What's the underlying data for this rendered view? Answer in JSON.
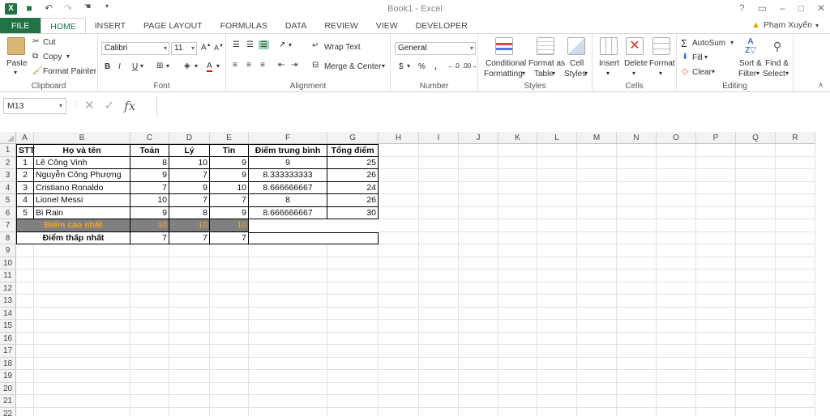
{
  "window": {
    "title": "Book1 - Excel",
    "help": "?",
    "restore": "□",
    "minimize": "–",
    "close": "✕"
  },
  "qat": {
    "save": "💾",
    "undo": "↶",
    "redo": "↷",
    "touch": "✋"
  },
  "tabs": [
    "FILE",
    "HOME",
    "INSERT",
    "PAGE LAYOUT",
    "FORMULAS",
    "DATA",
    "REVIEW",
    "VIEW",
    "DEVELOPER"
  ],
  "user": {
    "name": "Phạm Xuyến"
  },
  "ribbon": {
    "clipboard": {
      "label": "Clipboard",
      "paste": "Paste",
      "cut": "Cut",
      "copy": "Copy",
      "format_painter": "Format Painter"
    },
    "font": {
      "label": "Font",
      "name": "Calibri",
      "size": "11",
      "bold": "B",
      "italic": "I",
      "underline": "U"
    },
    "alignment": {
      "label": "Alignment",
      "wrap": "Wrap Text",
      "merge": "Merge & Center"
    },
    "number": {
      "label": "Number",
      "format": "General",
      "currency": "$",
      "percent": "%",
      "comma": ","
    },
    "styles": {
      "label": "Styles",
      "conditional_1": "Conditional",
      "conditional_2": "Formatting",
      "format_table_1": "Format as",
      "format_table_2": "Table",
      "cell_styles_1": "Cell",
      "cell_styles_2": "Styles"
    },
    "cells": {
      "label": "Cells",
      "insert": "Insert",
      "delete": "Delete",
      "format": "Format"
    },
    "editing": {
      "label": "Editing",
      "autosum": "AutoSum",
      "fill": "Fill",
      "clear": "Clear",
      "sort_1": "Sort &",
      "sort_2": "Filter",
      "find_1": "Find &",
      "find_2": "Select"
    }
  },
  "formula_bar": {
    "name_box": "M13",
    "cancel": "✕",
    "enter": "✓",
    "fx": "fx",
    "content": ""
  },
  "columns": [
    "A",
    "B",
    "C",
    "D",
    "E",
    "F",
    "G",
    "H",
    "I",
    "J",
    "K",
    "L",
    "M",
    "N",
    "O",
    "P",
    "Q",
    "R"
  ],
  "rows": [
    "1",
    "2",
    "3",
    "4",
    "5",
    "6",
    "7",
    "8",
    "9",
    "10",
    "11",
    "12",
    "13",
    "14",
    "15",
    "16",
    "17",
    "18",
    "19",
    "20",
    "21",
    "22"
  ],
  "sheet": {
    "header": [
      "STT",
      "Họ và tên",
      "Toán",
      "Lý",
      "Tin",
      "Điểm trung bình",
      "Tổng điểm"
    ],
    "students": [
      [
        "1",
        "Lê Công Vinh",
        "8",
        "10",
        "9",
        "9",
        "25"
      ],
      [
        "2",
        "Nguyễn Công Phượng",
        "9",
        "7",
        "9",
        "8.333333333",
        "26"
      ],
      [
        "3",
        "Cristiano Ronaldo",
        "7",
        "9",
        "10",
        "8.666666667",
        "24"
      ],
      [
        "4",
        "Lionel Messi",
        "10",
        "7",
        "7",
        "8",
        "26"
      ],
      [
        "5",
        "Bi Rain",
        "9",
        "8",
        "9",
        "8.666666667",
        "30"
      ]
    ],
    "max_row": [
      "Điểm cao nhất",
      "10",
      "10",
      "10"
    ],
    "min_row": [
      "Điểm thấp nhất",
      "7",
      "7",
      "7"
    ]
  }
}
